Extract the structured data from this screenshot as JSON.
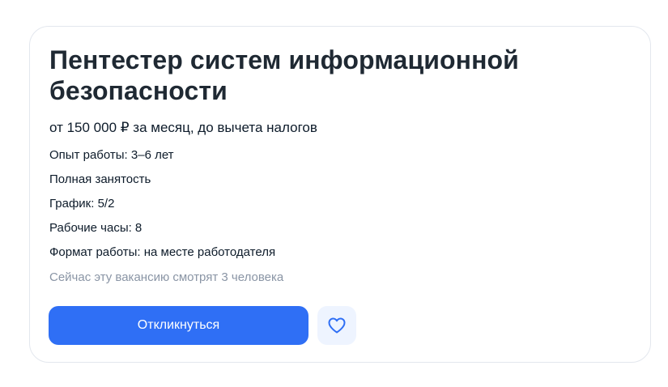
{
  "vacancy": {
    "title": "Пентестер систем информационной безопасности",
    "salary": "от 150 000 ₽ за месяц, до вычета налогов",
    "facts": [
      "Опыт работы: 3–6 лет",
      "Полная занятость",
      "График: 5/2",
      "Рабочие часы: 8",
      "Формат работы: на месте работодателя"
    ],
    "viewers": "Сейчас эту вакансию смотрят 3 человека"
  },
  "actions": {
    "apply_label": "Откликнуться",
    "favorite_icon": "heart-outline-icon"
  },
  "colors": {
    "accent": "#2f6ff5",
    "favorite_bg": "#eef4ff",
    "muted_text": "#8a95a5",
    "card_border": "#e3e7ee"
  }
}
